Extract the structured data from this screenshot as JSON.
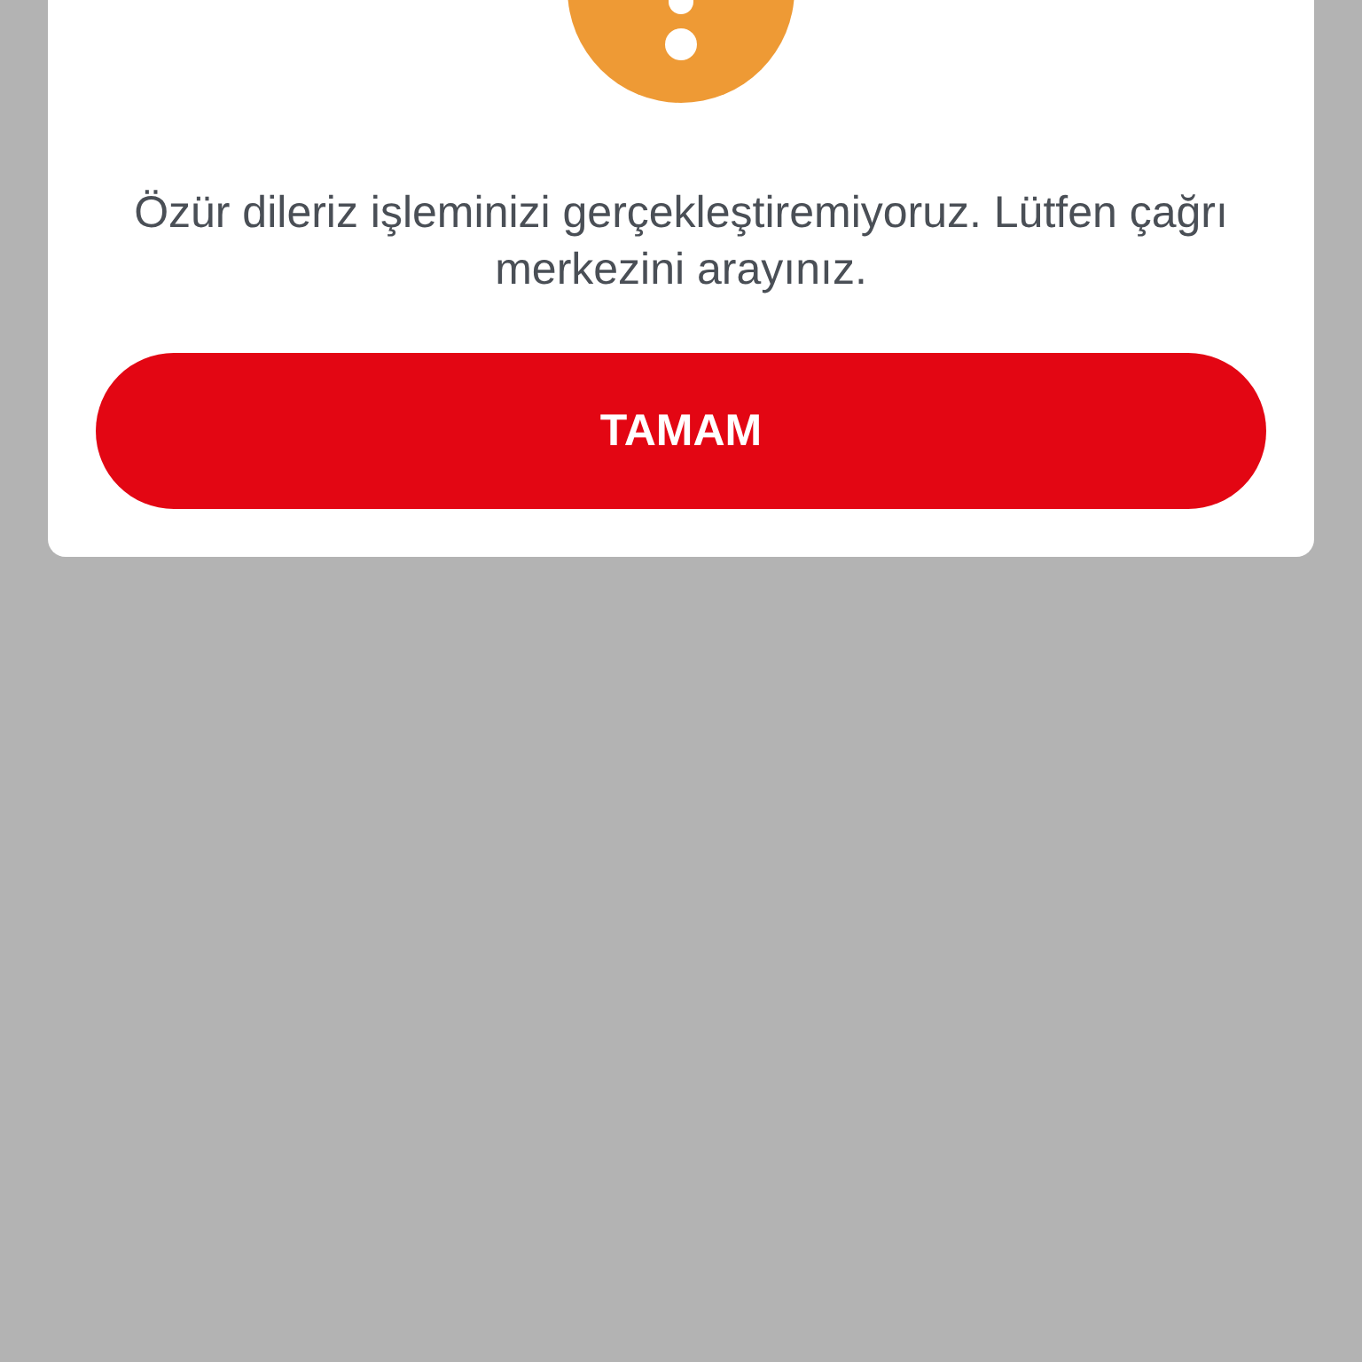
{
  "dialog": {
    "message": "Özür dileriz işleminizi gerçekleştiremiyoruz. Lütfen çağrı merkezini arayınız.",
    "button": "TAMAM"
  }
}
